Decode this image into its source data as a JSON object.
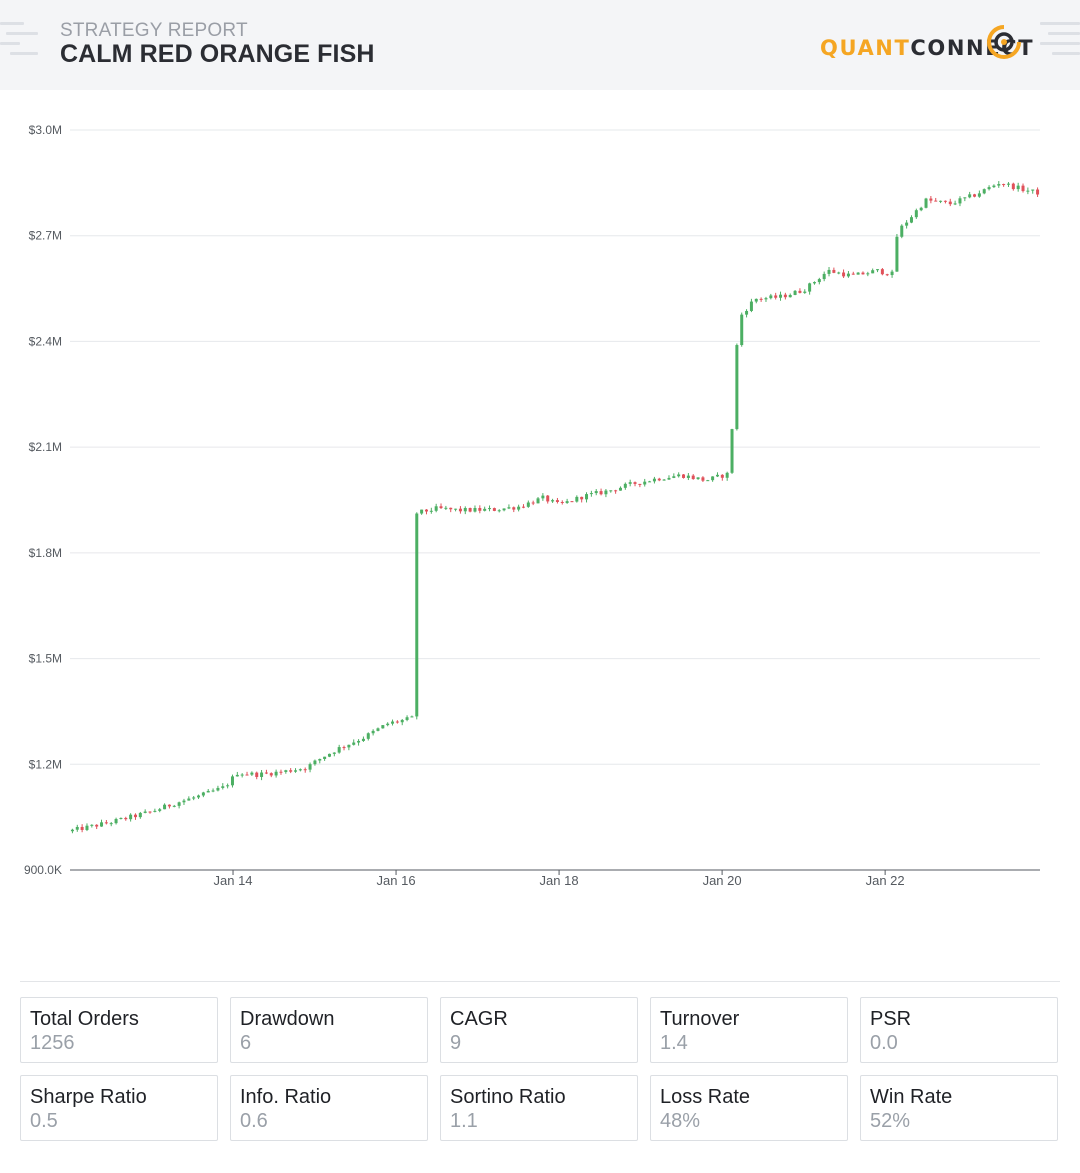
{
  "header": {
    "subtitle": "STRATEGY REPORT",
    "title": "CALM RED ORANGE FISH",
    "logo_left": "QUANT",
    "logo_right": "CONNECT"
  },
  "colors": {
    "up": "#4caf63",
    "down": "#e0515a",
    "grid": "#e6e8eb",
    "axis": "#555a60",
    "accent": "#f5a623"
  },
  "chart_data": {
    "type": "candlestick",
    "title": "",
    "xlabel": "",
    "ylabel": "",
    "ylim": [
      900000,
      3000000
    ],
    "y_ticks": [
      {
        "value": 900000,
        "label": "900.0K"
      },
      {
        "value": 1200000,
        "label": "$1.2M"
      },
      {
        "value": 1500000,
        "label": "$1.5M"
      },
      {
        "value": 1800000,
        "label": "$1.8M"
      },
      {
        "value": 2100000,
        "label": "$2.1M"
      },
      {
        "value": 2400000,
        "label": "$2.4M"
      },
      {
        "value": 2700000,
        "label": "$2.7M"
      },
      {
        "value": 3000000,
        "label": "$3.0M"
      }
    ],
    "xlim": [
      12.0,
      23.9
    ],
    "x_unit": "day of January",
    "x_ticks": [
      {
        "value": 14,
        "label": "Jan 14"
      },
      {
        "value": 16,
        "label": "Jan 16"
      },
      {
        "value": 18,
        "label": "Jan 18"
      },
      {
        "value": 20,
        "label": "Jan 20"
      },
      {
        "value": 22,
        "label": "Jan 22"
      }
    ],
    "grid": true,
    "close_points": [
      [
        12.0,
        1010000
      ],
      [
        12.5,
        1035000
      ],
      [
        13.0,
        1065000
      ],
      [
        13.3,
        1090000
      ],
      [
        13.6,
        1110000
      ],
      [
        13.9,
        1135000
      ],
      [
        14.05,
        1175000
      ],
      [
        14.3,
        1170000
      ],
      [
        14.6,
        1178000
      ],
      [
        14.9,
        1190000
      ],
      [
        15.1,
        1220000
      ],
      [
        15.3,
        1245000
      ],
      [
        15.6,
        1275000
      ],
      [
        15.9,
        1315000
      ],
      [
        16.2,
        1330000
      ],
      [
        16.21,
        1910000
      ],
      [
        16.5,
        1925000
      ],
      [
        16.8,
        1920000
      ],
      [
        17.2,
        1922000
      ],
      [
        17.5,
        1930000
      ],
      [
        17.8,
        1955000
      ],
      [
        18.0,
        1935000
      ],
      [
        18.3,
        1960000
      ],
      [
        18.6,
        1975000
      ],
      [
        18.9,
        1995000
      ],
      [
        19.2,
        2010000
      ],
      [
        19.5,
        2020000
      ],
      [
        19.8,
        2005000
      ],
      [
        20.1,
        2025000
      ],
      [
        20.15,
        2320000
      ],
      [
        20.22,
        2470000
      ],
      [
        20.4,
        2520000
      ],
      [
        20.7,
        2525000
      ],
      [
        21.0,
        2545000
      ],
      [
        21.3,
        2600000
      ],
      [
        21.6,
        2585000
      ],
      [
        21.9,
        2600000
      ],
      [
        22.1,
        2590000
      ],
      [
        22.15,
        2710000
      ],
      [
        22.5,
        2800000
      ],
      [
        22.8,
        2790000
      ],
      [
        23.1,
        2815000
      ],
      [
        23.4,
        2850000
      ],
      [
        23.7,
        2830000
      ],
      [
        23.9,
        2820000
      ]
    ]
  },
  "stats": [
    {
      "label": "Total Orders",
      "value": "1256"
    },
    {
      "label": "Drawdown",
      "value": "6"
    },
    {
      "label": "CAGR",
      "value": "9"
    },
    {
      "label": "Turnover",
      "value": "1.4"
    },
    {
      "label": "PSR",
      "value": "0.0"
    },
    {
      "label": "Sharpe Ratio",
      "value": "0.5"
    },
    {
      "label": "Info. Ratio",
      "value": "0.6"
    },
    {
      "label": "Sortino Ratio",
      "value": "1.1"
    },
    {
      "label": "Loss Rate",
      "value": "48%"
    },
    {
      "label": "Win Rate",
      "value": "52%"
    }
  ]
}
